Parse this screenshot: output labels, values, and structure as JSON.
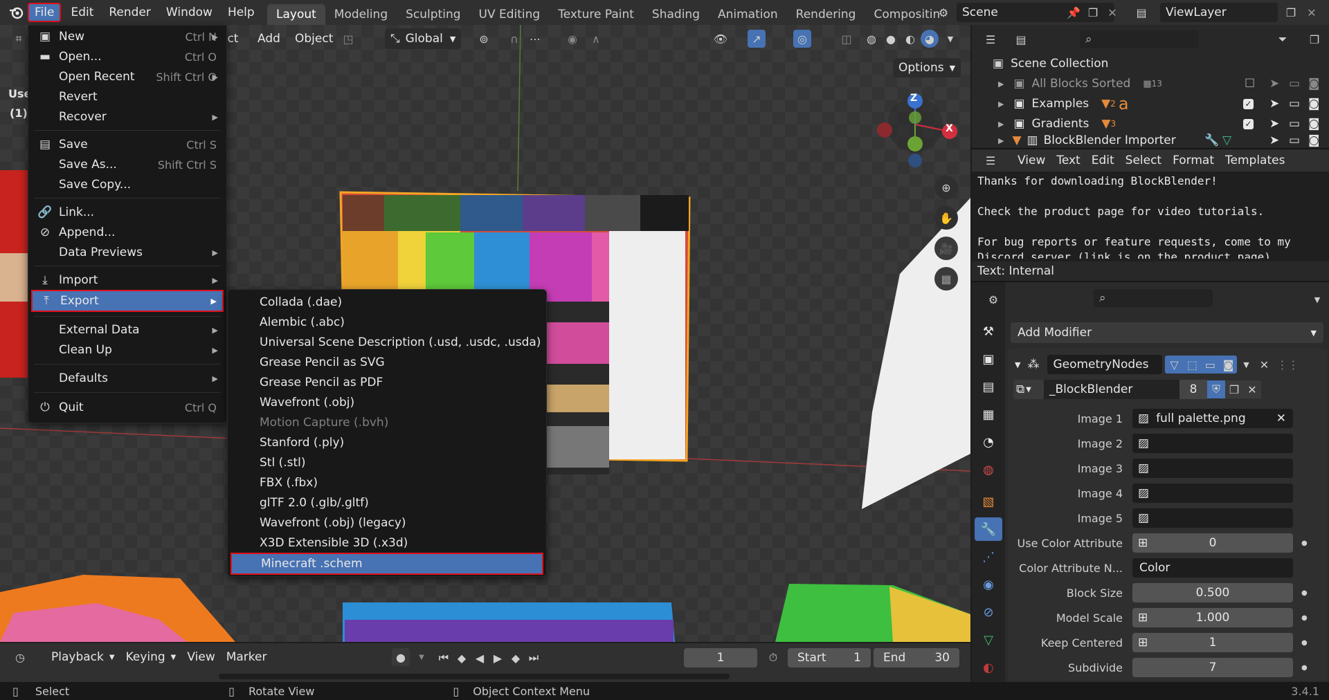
{
  "topbar": {
    "menus": [
      "File",
      "Edit",
      "Render",
      "Window",
      "Help"
    ],
    "workspaces": [
      "Layout",
      "Modeling",
      "Sculpting",
      "UV Editing",
      "Texture Paint",
      "Shading",
      "Animation",
      "Rendering",
      "Compositin"
    ],
    "active_workspace": "Layout",
    "scene": "Scene",
    "view_layer": "ViewLayer"
  },
  "viewport_header": {
    "menus": [
      "ect",
      "Add",
      "Object"
    ],
    "transform_orientation": "Global",
    "options_label": "Options",
    "overlay_text": [
      "Use",
      "(1)"
    ]
  },
  "file_menu": {
    "items": [
      {
        "label": "New",
        "shortcut": "Ctrl N",
        "icon": "new-file-icon",
        "arrow": "▶"
      },
      {
        "label": "Open...",
        "shortcut": "Ctrl O",
        "icon": "folder-icon"
      },
      {
        "label": "Open Recent",
        "shortcut": "Shift Ctrl O",
        "arrow": "▶"
      },
      {
        "label": "Revert"
      },
      {
        "label": "Recover",
        "arrow": "▶"
      },
      {
        "label": "Save",
        "shortcut": "Ctrl S",
        "icon": "save-icon"
      },
      {
        "label": "Save As...",
        "shortcut": "Shift Ctrl S"
      },
      {
        "label": "Save Copy..."
      },
      {
        "label": "Link...",
        "icon": "link-icon"
      },
      {
        "label": "Append...",
        "icon": "append-icon"
      },
      {
        "label": "Data Previews",
        "arrow": "▶"
      },
      {
        "label": "Import",
        "icon": "import-icon",
        "arrow": "▶"
      },
      {
        "label": "Export",
        "icon": "export-icon",
        "arrow": "▶"
      },
      {
        "label": "External Data",
        "arrow": "▶"
      },
      {
        "label": "Clean Up",
        "arrow": "▶"
      },
      {
        "label": "Defaults",
        "arrow": "▶"
      },
      {
        "label": "Quit",
        "shortcut": "Ctrl Q",
        "icon": "power-icon"
      }
    ]
  },
  "export_menu": {
    "items": [
      {
        "label": "Collada (.dae)"
      },
      {
        "label": "Alembic (.abc)"
      },
      {
        "label": "Universal Scene Description (.usd, .usdc, .usda)"
      },
      {
        "label": "Grease Pencil as SVG"
      },
      {
        "label": "Grease Pencil as PDF"
      },
      {
        "label": "Wavefront (.obj)"
      },
      {
        "label": "Motion Capture (.bvh)",
        "disabled": true
      },
      {
        "label": "Stanford (.ply)"
      },
      {
        "label": "Stl (.stl)"
      },
      {
        "label": "FBX (.fbx)"
      },
      {
        "label": "glTF 2.0 (.glb/.gltf)"
      },
      {
        "label": "Wavefront (.obj) (legacy)"
      },
      {
        "label": "X3D Extensible 3D (.x3d)"
      },
      {
        "label": "Minecraft .schem",
        "highlighted": true
      }
    ]
  },
  "gizmo": {
    "z": "Z",
    "x": "X"
  },
  "outliner": {
    "root": "Scene Collection",
    "rows": [
      {
        "label": "All Blocks Sorted",
        "badge": "13",
        "dimmed": true
      },
      {
        "label": "Examples",
        "badge": "2",
        "extra": "a"
      },
      {
        "label": "Gradients",
        "badge": "3"
      },
      {
        "label": "BlockBlender Importer"
      }
    ]
  },
  "text_editor": {
    "menus": [
      "View",
      "Text",
      "Edit",
      "Select",
      "Format",
      "Templates"
    ],
    "lines": [
      "Thanks for downloading BlockBlender!",
      "",
      "Check the product page for video tutorials.",
      "",
      "For bug reports or feature requests, come to my",
      "Discord server (link is on the product page)"
    ],
    "footer": "Text: Internal"
  },
  "properties": {
    "add_modifier_label": "Add Modifier",
    "modifier_name": "GeometryNodes",
    "node_group": "_BlockBlender",
    "node_group_users": "8",
    "rows": [
      {
        "label": "Image 1",
        "value": "full palette.png",
        "type": "image"
      },
      {
        "label": "Image 2",
        "value": "",
        "type": "image"
      },
      {
        "label": "Image 3",
        "value": "",
        "type": "image"
      },
      {
        "label": "Image 4",
        "value": "",
        "type": "image"
      },
      {
        "label": "Image 5",
        "value": "",
        "type": "image"
      },
      {
        "label": "Use Color Attribute",
        "value": "0",
        "type": "number"
      },
      {
        "label": "Color Attribute N...",
        "value": "Color",
        "type": "text"
      },
      {
        "label": "Block Size",
        "value": "0.500",
        "type": "number"
      },
      {
        "label": "Model Scale",
        "value": "1.000",
        "type": "number"
      },
      {
        "label": "Keep Centered",
        "value": "1",
        "type": "number"
      },
      {
        "label": "Subdivide",
        "value": "7",
        "type": "number"
      }
    ]
  },
  "timeline": {
    "menus": [
      "Playback",
      "Keying",
      "View",
      "Marker"
    ],
    "current_frame": "1",
    "start_label": "Start",
    "start": "1",
    "end_label": "End",
    "end": "30"
  },
  "statusbar": {
    "items": [
      "Select",
      "Rotate View",
      "Object Context Menu"
    ],
    "version": "3.4.1"
  },
  "colors": {
    "accent": "#4772b3",
    "highlight_border": "#e0101a",
    "selection_outline": "#f5a623"
  }
}
